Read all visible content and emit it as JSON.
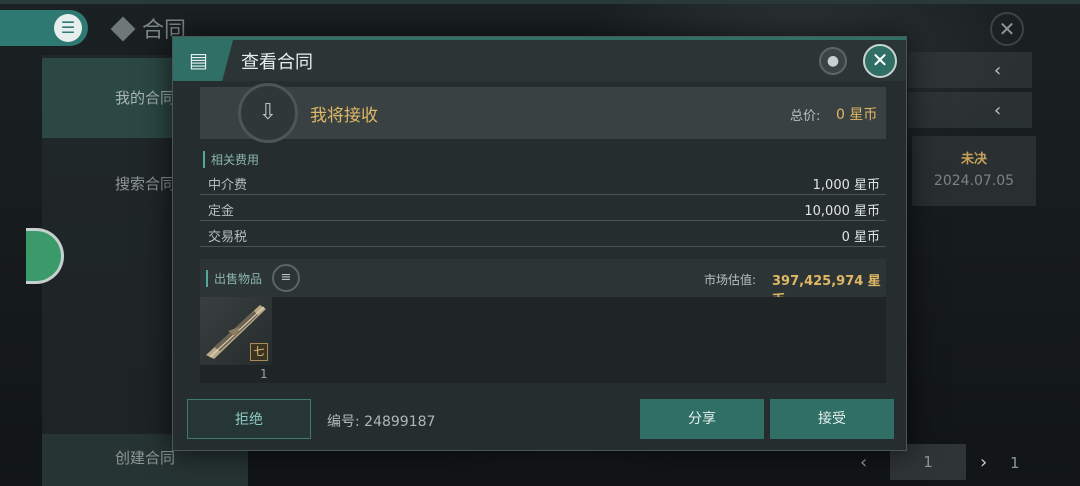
{
  "background": {
    "page_title": "合同",
    "sidebar": [
      {
        "label": "我的合同"
      },
      {
        "label": "搜索合同"
      },
      {
        "label": "创建合同"
      }
    ],
    "status_card": {
      "status": "未决",
      "date": "2024.07.05"
    },
    "pager": {
      "current": "1",
      "total": "1"
    }
  },
  "modal": {
    "title": "查看合同",
    "receive": {
      "label": "我将接收",
      "total_label": "总价:",
      "total_value": "0 星币"
    },
    "fees": {
      "section_title": "相关费用",
      "rows": [
        {
          "label": "中介费",
          "value": "1,000 星币"
        },
        {
          "label": "定金",
          "value": "10,000 星币"
        },
        {
          "label": "交易税",
          "value": "0 星币"
        }
      ]
    },
    "goods": {
      "section_title": "出售物品",
      "market_label": "市场估值:",
      "market_value": "397,425,974 星币",
      "items": [
        {
          "tier": "七",
          "count": "1"
        }
      ]
    },
    "footer": {
      "reject_label": "拒绝",
      "contract_no": "编号: 24899187",
      "share_label": "分享",
      "accept_label": "接受"
    }
  },
  "colors": {
    "accent": "#2f6f66",
    "gold": "#e0b764"
  }
}
